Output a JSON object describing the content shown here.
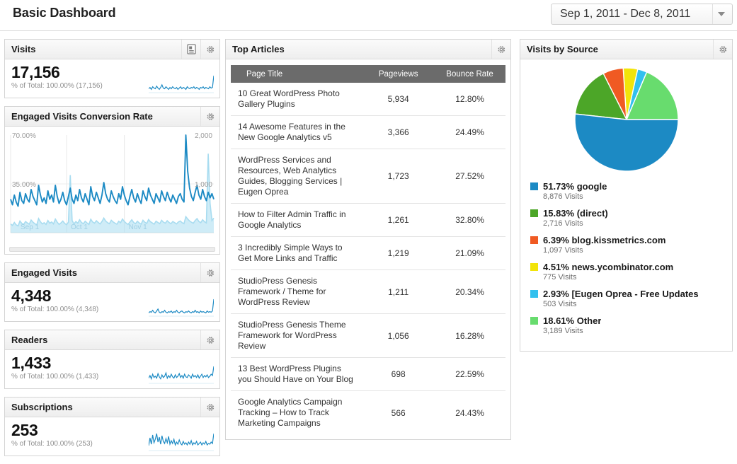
{
  "header": {
    "title": "Basic Dashboard",
    "date_range": "Sep 1, 2011 - Dec 8, 2011",
    "caret_icon": "chevron-down-icon"
  },
  "icons": {
    "gear": "gear-icon",
    "report": "report-icon"
  },
  "colors": {
    "series_primary": "#1c8ac4",
    "series_secondary": "#a8dcf0",
    "table_header_bg": "#6b6b6b",
    "panel_border": "#d4d4d4"
  },
  "widgets": {
    "visits": {
      "title": "Visits",
      "value": "17,156",
      "sub": "% of Total: 100.00% (17,156)"
    },
    "conversion": {
      "title": "Engaged Visits Conversion Rate"
    },
    "engaged_visits": {
      "title": "Engaged Visits",
      "value": "4,348",
      "sub": "% of Total: 100.00% (4,348)"
    },
    "readers": {
      "title": "Readers",
      "value": "1,433",
      "sub": "% of Total: 100.00% (1,433)"
    },
    "subscriptions": {
      "title": "Subscriptions",
      "value": "253",
      "sub": "% of Total: 100.00% (253)"
    },
    "top_articles": {
      "title": "Top Articles",
      "columns": [
        "Page Title",
        "Pageviews",
        "Bounce Rate"
      ],
      "rows": [
        {
          "title": "10 Great WordPress Photo Gallery Plugins",
          "pageviews": "5,934",
          "bounce": "12.80%"
        },
        {
          "title": "14 Awesome Features in the New Google Analytics v5",
          "pageviews": "3,366",
          "bounce": "24.49%"
        },
        {
          "title": "WordPress Services and Resources, Web Analytics Guides, Blogging Services | Eugen Oprea",
          "pageviews": "1,723",
          "bounce": "27.52%"
        },
        {
          "title": "How to Filter Admin Traffic in Google Analytics",
          "pageviews": "1,261",
          "bounce": "32.80%"
        },
        {
          "title": "3 Incredibly Simple Ways to Get More Links and Traffic",
          "pageviews": "1,219",
          "bounce": "21.09%"
        },
        {
          "title": "StudioPress Genesis Framework / Theme for WordPress Review",
          "pageviews": "1,211",
          "bounce": "20.34%"
        },
        {
          "title": "StudioPress Genesis Theme Framework for WordPress Review",
          "pageviews": "1,056",
          "bounce": "16.28%"
        },
        {
          "title": "13 Best WordPress Plugins you Should Have on Your Blog",
          "pageviews": "698",
          "bounce": "22.59%"
        },
        {
          "title": "Google Analytics Campaign Tracking – How to Track Marketing Campaigns",
          "pageviews": "566",
          "bounce": "24.43%"
        }
      ]
    },
    "visits_by_source": {
      "title": "Visits by Source"
    }
  },
  "chart_data": [
    {
      "id": "engaged_visits_conversion_rate",
      "type": "line",
      "title": "Engaged Visits Conversion Rate",
      "xlabel": "",
      "ylabel": "",
      "grid": true,
      "legend_position": "none",
      "y_left_ticks": [
        "35.00%",
        "70.00%"
      ],
      "y_left_values": [
        35,
        70
      ],
      "ylim_left": [
        0,
        70
      ],
      "y_right_ticks": [
        "1,000",
        "2,000"
      ],
      "y_right_values": [
        1000,
        2000
      ],
      "ylim_right": [
        0,
        2000
      ],
      "x_ticks": [
        "Sep 1",
        "Oct 1",
        "Nov 1"
      ],
      "series": [
        {
          "name": "Engaged Visits Conversion Rate",
          "axis": "left",
          "color": "#1c8ac4",
          "values": [
            24,
            20,
            27,
            22,
            19,
            29,
            23,
            21,
            28,
            24,
            22,
            31,
            26,
            23,
            20,
            34,
            27,
            22,
            25,
            21,
            30,
            24,
            27,
            22,
            34,
            26,
            21,
            24,
            29,
            23,
            20,
            26,
            32,
            24,
            21,
            27,
            23,
            31,
            25,
            22,
            28,
            24,
            20,
            33,
            26,
            23,
            29,
            25,
            21,
            27,
            36,
            28,
            24,
            22,
            30,
            26,
            23,
            21,
            28,
            24,
            33,
            27,
            23,
            20,
            26,
            31,
            25,
            22,
            28,
            24,
            21,
            30,
            26,
            23,
            32,
            27,
            24,
            21,
            28,
            25,
            22,
            30,
            26,
            23,
            29,
            25,
            22,
            27,
            24,
            21,
            26,
            28,
            24,
            22,
            70,
            44,
            32,
            26,
            23,
            29,
            34,
            27,
            24,
            31,
            26,
            23,
            29,
            25,
            28,
            24
          ]
        },
        {
          "name": "Engaged Visits",
          "axis": "right",
          "color": "#a8dcf0",
          "fill": true,
          "values": [
            180,
            150,
            210,
            160,
            140,
            240,
            190,
            170,
            230,
            200,
            175,
            260,
            215,
            185,
            160,
            290,
            225,
            180,
            205,
            170,
            250,
            195,
            220,
            180,
            280,
            215,
            170,
            200,
            240,
            190,
            165,
            215,
            1180,
            250,
            180,
            230,
            195,
            265,
            210,
            185,
            235,
            200,
            170,
            275,
            220,
            195,
            245,
            210,
            180,
            230,
            300,
            240,
            205,
            185,
            255,
            220,
            195,
            175,
            235,
            205,
            280,
            230,
            195,
            170,
            220,
            265,
            210,
            185,
            235,
            200,
            175,
            255,
            215,
            190,
            270,
            225,
            200,
            175,
            235,
            210,
            185,
            255,
            215,
            195,
            245,
            210,
            185,
            230,
            205,
            180,
            220,
            240,
            205,
            185,
            330,
            280,
            240,
            215,
            195,
            250,
            290,
            230,
            205,
            265,
            225,
            200,
            1620,
            600,
            250,
            300
          ]
        }
      ]
    },
    {
      "id": "visits_by_source",
      "type": "pie",
      "title": "Visits by Source",
      "legend_position": "bottom",
      "labels": [
        "google",
        "(direct)",
        "blog.kissmetrics.com",
        "news.ycombinator.com",
        "[Eugen Oprea - Free Updates",
        "Other"
      ],
      "percents": [
        "51.73%",
        "15.83%",
        "6.39%",
        "4.51%",
        "2.93%",
        "18.61%"
      ],
      "values": [
        51.73,
        15.83,
        6.39,
        4.51,
        2.93,
        18.61
      ],
      "visit_counts": [
        "8,876 Visits",
        "2,716 Visits",
        "1,097 Visits",
        "775 Visits",
        "503 Visits",
        "3,189 Visits"
      ],
      "colors": [
        "#1c8ac4",
        "#4ca628",
        "#f05a23",
        "#f2e40a",
        "#32c0ee",
        "#68dc6e"
      ]
    },
    {
      "id": "visits_sparkline",
      "type": "line",
      "values": [
        6,
        8,
        5,
        9,
        7,
        6,
        10,
        7,
        5,
        8,
        12,
        7,
        6,
        9,
        7,
        5,
        8,
        6,
        9,
        7,
        6,
        8,
        5,
        7,
        9,
        6,
        8,
        7,
        5,
        9,
        7,
        6,
        8,
        7,
        9,
        6,
        8,
        7,
        5,
        8,
        7,
        9,
        6,
        8,
        7,
        6,
        9,
        7,
        8,
        26
      ]
    },
    {
      "id": "engaged_visits_sparkline",
      "type": "line",
      "values": [
        5,
        7,
        6,
        9,
        6,
        5,
        8,
        11,
        6,
        5,
        7,
        6,
        9,
        6,
        5,
        7,
        6,
        8,
        5,
        7,
        6,
        9,
        6,
        5,
        7,
        8,
        6,
        5,
        7,
        6,
        8,
        6,
        5,
        7,
        6,
        9,
        6,
        7,
        5,
        8,
        6,
        7,
        6,
        5,
        8,
        6,
        7,
        6,
        8,
        26
      ]
    },
    {
      "id": "readers_sparkline",
      "type": "line",
      "values": [
        8,
        12,
        7,
        14,
        9,
        11,
        8,
        15,
        10,
        7,
        13,
        9,
        11,
        16,
        8,
        12,
        9,
        14,
        10,
        8,
        13,
        9,
        11,
        15,
        9,
        12,
        8,
        14,
        10,
        9,
        13,
        11,
        8,
        14,
        10,
        12,
        9,
        13,
        8,
        11,
        14,
        9,
        12,
        10,
        13,
        9,
        11,
        14,
        12,
        26
      ]
    },
    {
      "id": "subscriptions_sparkline",
      "type": "line",
      "values": [
        7,
        18,
        9,
        22,
        11,
        16,
        24,
        12,
        19,
        9,
        21,
        13,
        10,
        17,
        11,
        20,
        9,
        14,
        10,
        16,
        8,
        12,
        9,
        15,
        10,
        8,
        13,
        9,
        11,
        8,
        12,
        9,
        14,
        8,
        11,
        9,
        13,
        8,
        10,
        12,
        8,
        11,
        9,
        13,
        8,
        10,
        9,
        12,
        10,
        24
      ]
    }
  ]
}
